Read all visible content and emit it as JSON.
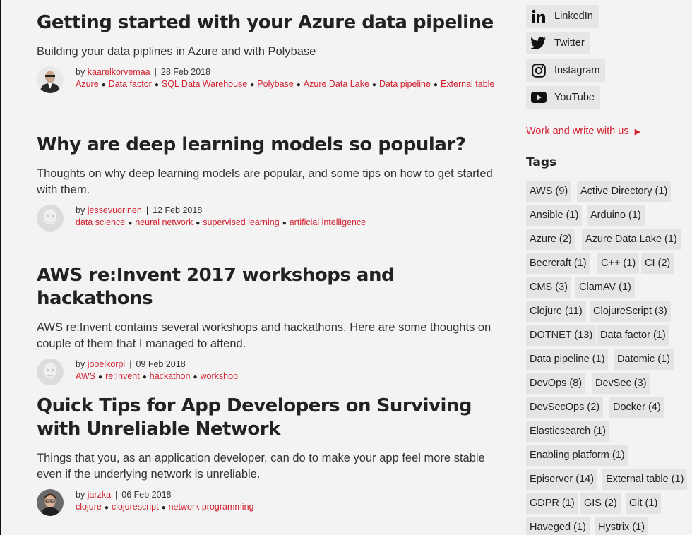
{
  "posts": [
    {
      "title": "Getting started with your Azure data pipeline",
      "excerpt": "Building your data piplines in Azure and with Polybase",
      "by": "by",
      "author": "kaarelkorvemaa",
      "date": "28 Feb 2018",
      "tags": [
        "Azure",
        "Data factor",
        "SQL Data Warehouse",
        "Polybase",
        "Azure Data Lake",
        "Data pipeline",
        "External table"
      ]
    },
    {
      "title": "Why are deep learning models so popular?",
      "excerpt": "Thoughts on why deep learning models are popular, and some tips on how to get started with them.",
      "by": "by",
      "author": "jessevuorinen",
      "date": "12 Feb 2018",
      "tags": [
        "data science",
        "neural network",
        "supervised learning",
        "artificial intelligence"
      ]
    },
    {
      "title": "AWS re:Invent 2017 workshops and hackathons",
      "excerpt": "AWS re:Invent contains several workshops and hackathons. Here are some thoughts on couple of them that I managed to attend.",
      "by": "by",
      "author": "jooelkorpi",
      "date": "09 Feb 2018",
      "tags": [
        "AWS",
        "re:Invent",
        "hackathon",
        "workshop"
      ]
    },
    {
      "title": "Quick Tips for App Developers on Surviving with Unreliable Network",
      "excerpt": "Things that you, as an application developer, can do to make your app feel more stable even if the underlying network is unreliable.",
      "by": "by",
      "author": "jarzka",
      "date": "06 Feb 2018",
      "tags": [
        "clojure",
        "clojurescript",
        "network programming"
      ]
    }
  ],
  "sidebar": {
    "social": [
      {
        "label": "LinkedIn",
        "icon": "linkedin-icon"
      },
      {
        "label": "Twitter",
        "icon": "twitter-icon"
      },
      {
        "label": "Instagram",
        "icon": "instagram-icon"
      },
      {
        "label": "YouTube",
        "icon": "youtube-icon"
      }
    ],
    "work_link": "Work and write with us",
    "work_arrow": "▶",
    "tags_heading": "Tags",
    "tags": [
      "AWS (9)",
      "Active Directory (1)",
      "Ansible (1)",
      "Arduino (1)",
      "Azure (2)",
      "Azure Data Lake (1)",
      "Beercraft (1)",
      "C++ (1)",
      "CI (2)",
      "CMS (3)",
      "ClamAV (1)",
      "Clojure (11)",
      "ClojureScript (3)",
      "DOTNET (13)",
      "Data factor (1)",
      "Data pipeline (1)",
      "Datomic (1)",
      "DevOps (8)",
      "DevSec (3)",
      "DevSecOps (2)",
      "Docker (4)",
      "Elasticsearch (1)",
      "Enabling platform (1)",
      "Episerver (14)",
      "External table (1)",
      "GDPR (1)",
      "GIS (2)",
      "Git (1)",
      "Haveged (1)",
      "Hystrix (1)"
    ]
  },
  "colors": {
    "accent": "#d32130",
    "background": "#f3f3f3",
    "tag_bg": "#e4e4e4"
  }
}
